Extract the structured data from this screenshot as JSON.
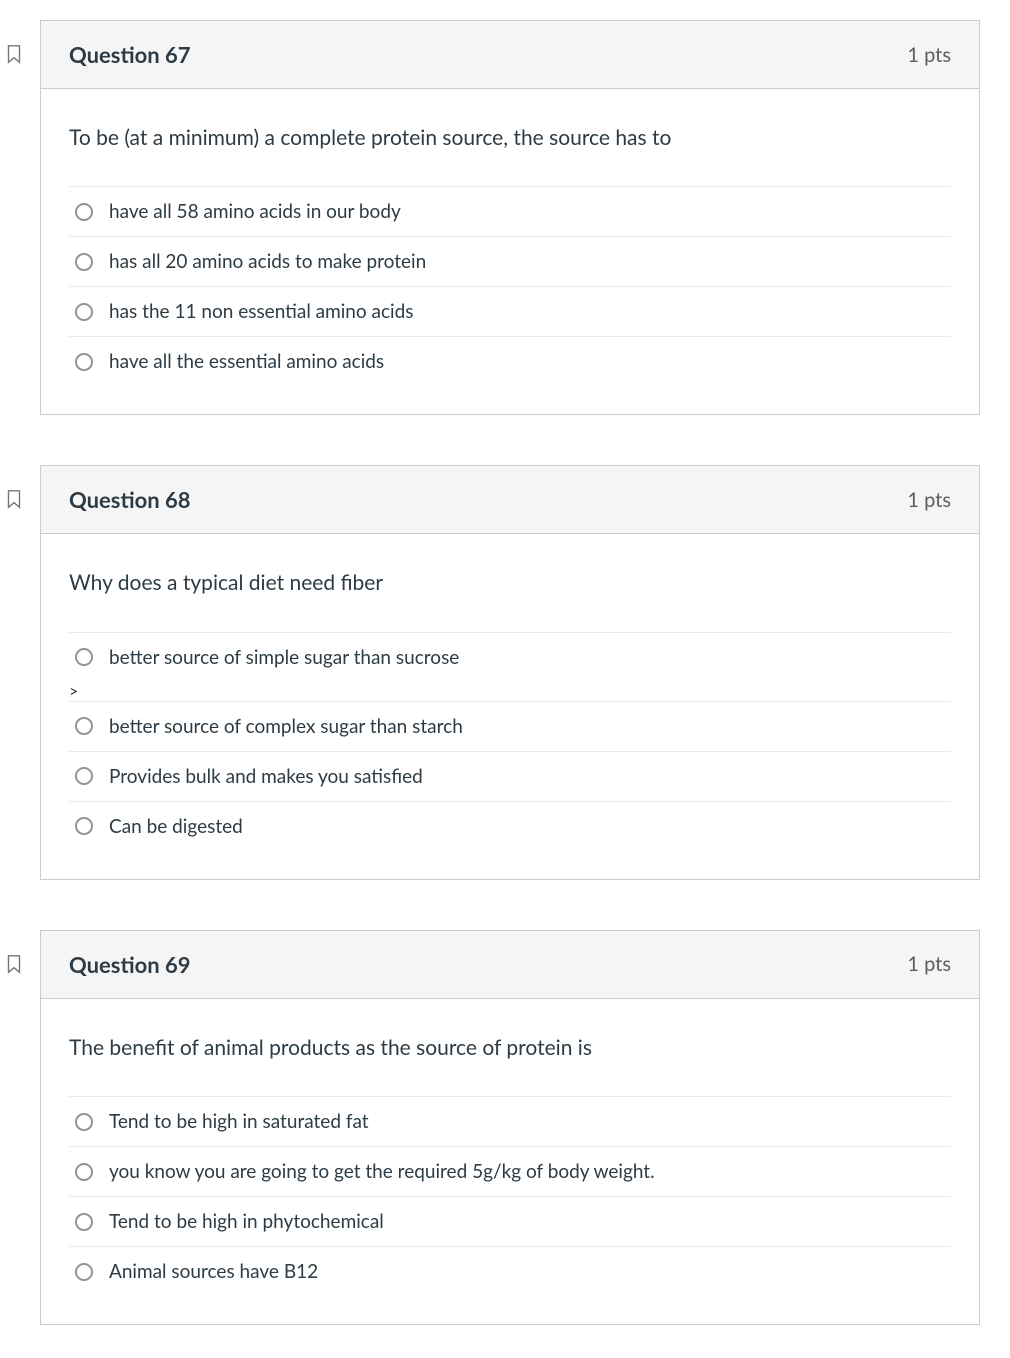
{
  "questions": [
    {
      "title": "Question 67",
      "points": "1 pts",
      "prompt": "To be (at a minimum) a complete protein source, the source has to",
      "answers": [
        "have all 58 amino acids in our body",
        "has all 20 amino acids to make protein",
        "has the 11 non essential amino acids",
        "have all the essential amino acids"
      ]
    },
    {
      "title": "Question 68",
      "points": "1 pts",
      "prompt": "Why does a typical diet need fiber",
      "answers": [
        "better source of simple sugar than sucrose",
        "better source of complex sugar than starch",
        "Provides bulk and makes you satisfied",
        "Can be digested"
      ]
    },
    {
      "title": "Question 69",
      "points": "1 pts",
      "prompt": "The benefit of animal products as the source of protein is",
      "answers": [
        "Tend to be high in saturated fat",
        "you know you are going to get the required 5g/kg of body weight.",
        "Tend to be high in phytochemical",
        "Animal sources have B12"
      ]
    }
  ]
}
